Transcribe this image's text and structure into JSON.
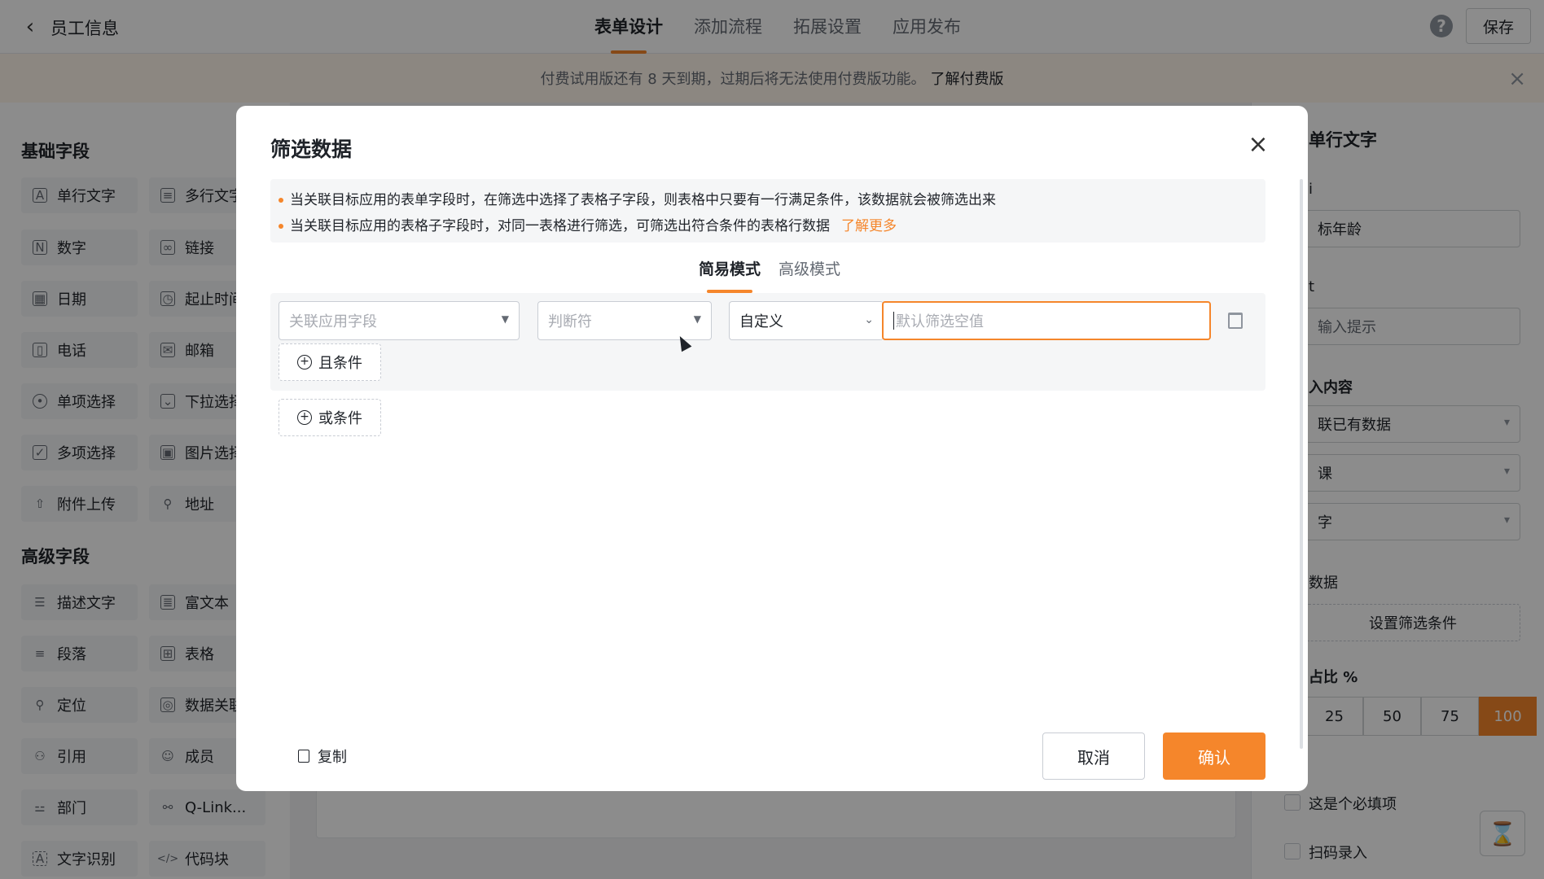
{
  "header": {
    "title": "员工信息",
    "nav": [
      "表单设计",
      "添加流程",
      "拓展设置",
      "应用发布"
    ],
    "active_nav": "表单设计",
    "help": "?",
    "save": "保存"
  },
  "notice": {
    "text": "付费试用版还有 8 天到期，过期后将无法使用付费版功能。",
    "link": "了解付费版"
  },
  "left_panel": {
    "basic_title": "基础字段",
    "basic_fields": [
      {
        "label": "单行文字",
        "icon": "text-icon"
      },
      {
        "label": "多行文字",
        "icon": "multiline-text-icon"
      },
      {
        "label": "数字",
        "icon": "number-icon"
      },
      {
        "label": "链接",
        "icon": "link-icon"
      },
      {
        "label": "日期",
        "icon": "calendar-icon"
      },
      {
        "label": "起止时间",
        "icon": "time-range-icon"
      },
      {
        "label": "电话",
        "icon": "phone-icon"
      },
      {
        "label": "邮箱",
        "icon": "mail-icon"
      },
      {
        "label": "单项选择",
        "icon": "radio-icon"
      },
      {
        "label": "下拉选择",
        "icon": "dropdown-icon"
      },
      {
        "label": "多项选择",
        "icon": "checkbox-icon"
      },
      {
        "label": "图片选择",
        "icon": "image-icon"
      },
      {
        "label": "附件上传",
        "icon": "upload-icon"
      },
      {
        "label": "地址",
        "icon": "location-icon"
      }
    ],
    "advanced_title": "高级字段",
    "advanced_fields": [
      {
        "label": "描述文字",
        "icon": "description-icon"
      },
      {
        "label": "富文本",
        "icon": "rich-text-icon"
      },
      {
        "label": "段落",
        "icon": "paragraph-icon"
      },
      {
        "label": "表格",
        "icon": "table-icon"
      },
      {
        "label": "定位",
        "icon": "pin-icon"
      },
      {
        "label": "数据关联",
        "icon": "data-link-icon"
      },
      {
        "label": "引用",
        "icon": "reference-icon"
      },
      {
        "label": "成员",
        "icon": "member-icon"
      },
      {
        "label": "部门",
        "icon": "department-icon"
      },
      {
        "label": "Q-Link...",
        "icon": "qlink-icon"
      },
      {
        "label": "文字识别",
        "icon": "ocr-icon"
      },
      {
        "label": "代码块",
        "icon": "code-icon"
      }
    ]
  },
  "right_panel": {
    "title": "单行文字",
    "field_a_label": "i",
    "field_a_value": "标年龄",
    "field_b_label": "t",
    "field_b_placeholder": "输入提示",
    "content_label": "入内容",
    "select_1": "联已有数据",
    "select_2": "课",
    "select_3": "字",
    "filter_label": "数据",
    "filter_button": "设置筛选条件",
    "width_label": "占比 %",
    "width_options": [
      "25",
      "50",
      "75",
      "100"
    ],
    "width_selected": "100",
    "required_label": "这是个必填项",
    "scan_label": "扫码录入"
  },
  "modal": {
    "title": "筛选数据",
    "tips": [
      "当关联目标应用的表单字段时，在筛选中选择了表格子字段，则表格中只要有一行满足条件，该数据就会被筛选出来",
      "当关联目标应用的表格子字段时，对同一表格进行筛选，可筛选出符合条件的表格行数据"
    ],
    "learn_more": "了解更多",
    "modes": [
      "简易模式",
      "高级模式"
    ],
    "active_mode": "简易模式",
    "condition": {
      "field_placeholder": "关联应用字段",
      "operator_placeholder": "判断符",
      "value_type": "自定义",
      "value_placeholder": "默认筛选空值"
    },
    "and_button": "且条件",
    "or_button": "或条件",
    "copy": "复制",
    "cancel": "取消",
    "confirm": "确认"
  }
}
